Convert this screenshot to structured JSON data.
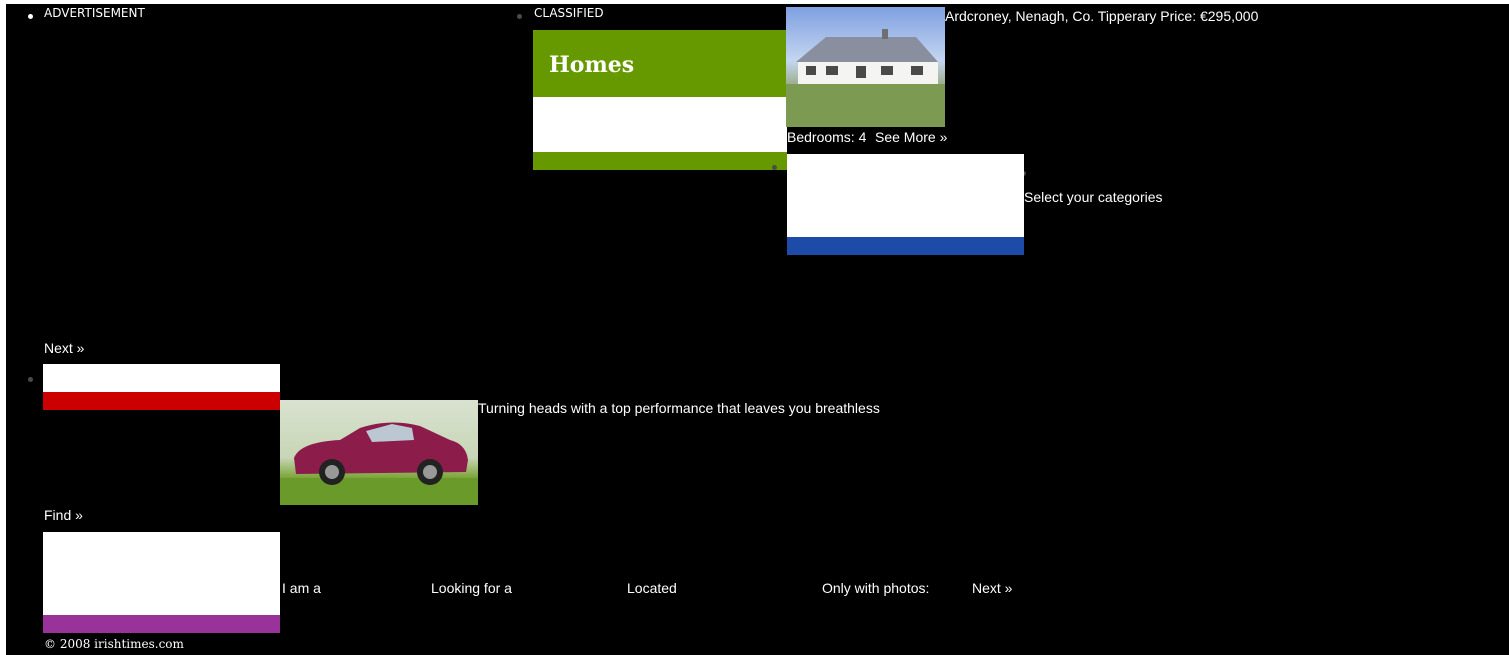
{
  "ad": {
    "label": "ADVERTISEMENT"
  },
  "classified": {
    "label": "CLASSIFIED"
  },
  "homes": {
    "title": "Homes",
    "brand_color": "#669900",
    "listing": {
      "location_price": "Ardcroney, Nenagh, Co. Tipperary Price: €295,000",
      "bedrooms": "Bedrooms: 4",
      "see_more": "See More »",
      "image": "house-photo"
    }
  },
  "jobs": {
    "brand_color": "#1c4ca8",
    "select_categories": "Select your categories",
    "next_label": "Next »"
  },
  "motors": {
    "brand_color": "#cc0000",
    "tagline": "Turning heads with a top performance that leaves you breathless",
    "image": "car-photo",
    "find_label": "Find »"
  },
  "dating": {
    "brand_color": "#993399",
    "i_am_a": "I am a",
    "looking_for": "Looking for a",
    "located": "Located",
    "only_with_photos": "Only with photos:",
    "next_label": "Next »"
  },
  "footer": {
    "copyright": "© 2008 irishtimes.com"
  }
}
